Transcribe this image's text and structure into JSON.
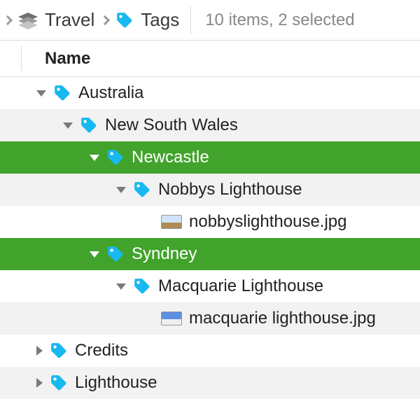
{
  "colors": {
    "tag_blue": "#18b8f0",
    "selection_green": "#41a32b"
  },
  "breadcrumb": {
    "parent_label": "Travel",
    "current_label": "Tags"
  },
  "status_text": "10 items, 2 selected",
  "column_header": "Name",
  "rows": [
    {
      "id": "australia",
      "label": "Australia",
      "depth": 1,
      "expanded": true,
      "kind": "tag",
      "selected": false,
      "stripe": false
    },
    {
      "id": "nsw",
      "label": "New South Wales",
      "depth": 2,
      "expanded": true,
      "kind": "tag",
      "selected": false,
      "stripe": true
    },
    {
      "id": "newcastle",
      "label": "Newcastle",
      "depth": 3,
      "expanded": true,
      "kind": "tag",
      "selected": true,
      "stripe": false
    },
    {
      "id": "nobbys",
      "label": "Nobbys Lighthouse",
      "depth": 4,
      "expanded": true,
      "kind": "tag",
      "selected": false,
      "stripe": true
    },
    {
      "id": "nobbysjpg",
      "label": "nobbyslighthouse.jpg",
      "depth": 5,
      "expanded": null,
      "kind": "file",
      "selected": false,
      "stripe": false
    },
    {
      "id": "sydney",
      "label": "Syndney",
      "depth": 3,
      "expanded": true,
      "kind": "tag",
      "selected": true,
      "stripe": false
    },
    {
      "id": "macquarie",
      "label": "Macquarie Lighthouse",
      "depth": 4,
      "expanded": true,
      "kind": "tag",
      "selected": false,
      "stripe": false
    },
    {
      "id": "macjpg",
      "label": "macquarie lighthouse.jpg",
      "depth": 5,
      "expanded": null,
      "kind": "file",
      "selected": false,
      "stripe": true
    },
    {
      "id": "credits",
      "label": "Credits",
      "depth": 1,
      "expanded": false,
      "kind": "tag",
      "selected": false,
      "stripe": false
    },
    {
      "id": "lighthouse",
      "label": "Lighthouse",
      "depth": 1,
      "expanded": false,
      "kind": "tag",
      "selected": false,
      "stripe": true
    }
  ]
}
